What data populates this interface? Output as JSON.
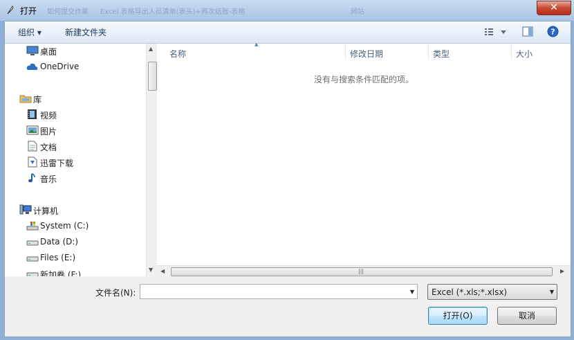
{
  "window": {
    "title": "打开",
    "close_label": "✕"
  },
  "background_tabs": [
    "如何提交作業",
    "Excel 表格导出人员清单(表头)+再次结账-表格",
    "网站"
  ],
  "toolbar": {
    "organize": "组织 ▾",
    "new_folder": "新建文件夹"
  },
  "nav": {
    "favorites": [
      {
        "label": "桌面",
        "icon": "desktop-icon"
      },
      {
        "label": "OneDrive",
        "icon": "cloud-icon"
      }
    ],
    "libraries_header": "库",
    "libraries": [
      {
        "label": "视频",
        "icon": "video-icon"
      },
      {
        "label": "图片",
        "icon": "picture-icon"
      },
      {
        "label": "文档",
        "icon": "document-icon"
      },
      {
        "label": "迅雷下载",
        "icon": "download-icon"
      },
      {
        "label": "音乐",
        "icon": "music-icon"
      }
    ],
    "computer_header": "计算机",
    "drives": [
      {
        "label": "System (C:)",
        "icon": "system-drive-icon"
      },
      {
        "label": "Data (D:)",
        "icon": "drive-icon"
      },
      {
        "label": "Files (E:)",
        "icon": "drive-icon"
      },
      {
        "label": "新加卷 (F:)",
        "icon": "drive-icon"
      }
    ]
  },
  "columns": [
    "名称",
    "修改日期",
    "类型",
    "大小"
  ],
  "empty_message": "没有与搜索条件匹配的项。",
  "filename": {
    "label": "文件名(N):",
    "value": ""
  },
  "filter": {
    "selected": "Excel (*.xls;*.xlsx)"
  },
  "buttons": {
    "open": "打开(O)",
    "cancel": "取消"
  },
  "colors": {
    "accent": "#1e3a5f",
    "titlebar": "#a9c4e4",
    "close": "#c74a35"
  }
}
